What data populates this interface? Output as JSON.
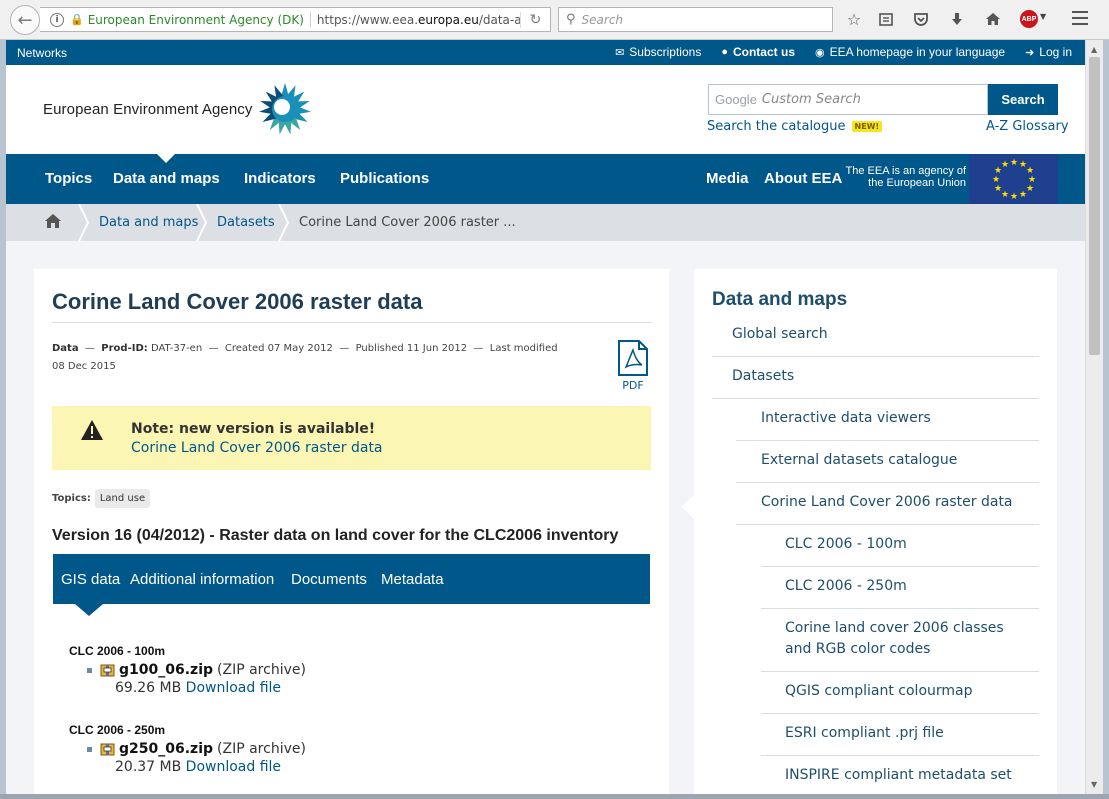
{
  "browser": {
    "site_identity": "European Environment Agency (DK)",
    "url_prefix": "https://www.eea.",
    "url_domain": "europa.eu",
    "url_suffix": "/data-and-ma",
    "search_placeholder": "Search",
    "abp_label": "ABP"
  },
  "topbar": {
    "networks": "Networks",
    "subscriptions": "Subscriptions",
    "contact": "Contact us",
    "homepage_lang": "EEA homepage in your language",
    "login": "Log in"
  },
  "header": {
    "org_name": "European Environment Agency",
    "search_google": "Google",
    "search_placeholder": "Custom Search",
    "search_button": "Search",
    "catalogue_link": "Search the catalogue",
    "new_badge": "NEW!",
    "glossary_link": "A-Z Glossary"
  },
  "nav": {
    "items": [
      "Topics",
      "Data and maps",
      "Indicators",
      "Publications"
    ],
    "right": [
      "Media",
      "About EEA"
    ],
    "agency_line1": "The EEA is an agency of",
    "agency_line2": "the European Union"
  },
  "breadcrumb": [
    "Data and maps",
    "Datasets",
    "Corine Land Cover 2006 raster ..."
  ],
  "content": {
    "title": "Corine Land Cover 2006 raster data",
    "meta": {
      "type": "Data",
      "prod_label": "Prod-ID:",
      "prod_id": "DAT-37-en",
      "created": "Created 07 May 2012",
      "published": "Published 11 Jun 2012",
      "modified_label": "Last modified",
      "modified_date": "08 Dec 2015"
    },
    "pdf_label": "PDF",
    "note_title": "Note: new version is available!",
    "note_link": "Corine Land Cover 2006 raster data",
    "topics_label": "Topics:",
    "topic_tag": "Land use",
    "version_heading": "Version 16 (04/2012) - Raster data on land cover for the CLC2006 inventory",
    "tabs": [
      "GIS data",
      "Additional information",
      "Documents",
      "Metadata"
    ],
    "downloads": [
      {
        "heading": "CLC 2006 - 100m",
        "file": "g100_06.zip",
        "type": "(ZIP archive)",
        "size": "69.26 MB",
        "link": "Download file"
      },
      {
        "heading": "CLC 2006 - 250m",
        "file": "g250_06.zip",
        "type": "(ZIP archive)",
        "size": "20.37 MB",
        "link": "Download file"
      }
    ]
  },
  "sidebar": {
    "title": "Data and maps",
    "level1": [
      "Global search",
      "Datasets"
    ],
    "level2": [
      "Interactive data viewers",
      "External datasets catalogue",
      "Corine Land Cover 2006 raster data"
    ],
    "level3": [
      "CLC 2006 - 100m",
      "CLC 2006 - 250m",
      "Corine land cover 2006 classes and RGB color codes",
      "QGIS compliant colourmap",
      "ESRI compliant .prj file",
      "INSPIRE compliant metadata set"
    ]
  }
}
